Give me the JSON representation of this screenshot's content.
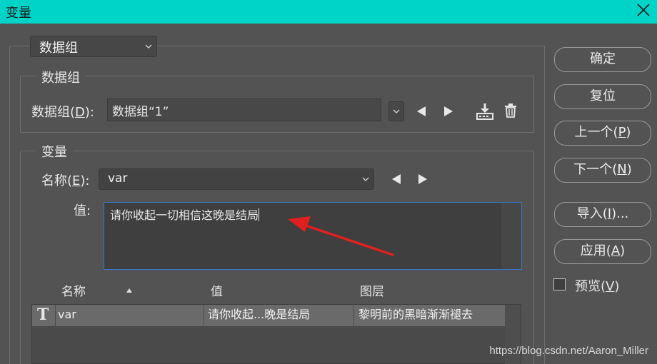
{
  "window": {
    "title": "变量"
  },
  "top_dropdown": {
    "selected": "数据组"
  },
  "datagroup": {
    "legend": "数据组",
    "label": "数据组(",
    "label_key": "D",
    "label_end": "):",
    "value": "数据组“1”"
  },
  "variable": {
    "legend": "变量",
    "name_label": "名称(",
    "name_key": "E",
    "name_end": "):",
    "name_value": "var",
    "value_label": "值:",
    "value_text": "请你收起一切相信这晚是结局"
  },
  "table": {
    "headers": [
      "名称",
      "值",
      "图层"
    ],
    "rows": [
      {
        "type_icon": "T",
        "name": "var",
        "value": "请你收起...晚是结局",
        "layer": "黎明前的黑暗渐渐褪去"
      }
    ]
  },
  "buttons": {
    "ok": "确定",
    "reset": "复位",
    "prev_pre": "上一个(",
    "prev_key": "P",
    "prev_end": ")",
    "next_pre": "下一个(",
    "next_key": "N",
    "next_end": ")",
    "import_pre": "导入(",
    "import_key": "I",
    "import_end": ")...",
    "apply_pre": "应用(",
    "apply_key": "A",
    "apply_end": ")"
  },
  "preview": {
    "pre": "预览(",
    "key": "V",
    "end": ")",
    "checked": false
  },
  "watermark": "https://blog.csdn.net/Aaron_Miller",
  "colors": {
    "titlebar": "#00d4c8",
    "annotation_arrow": "#e02020",
    "focus_border": "#3a78c8"
  }
}
